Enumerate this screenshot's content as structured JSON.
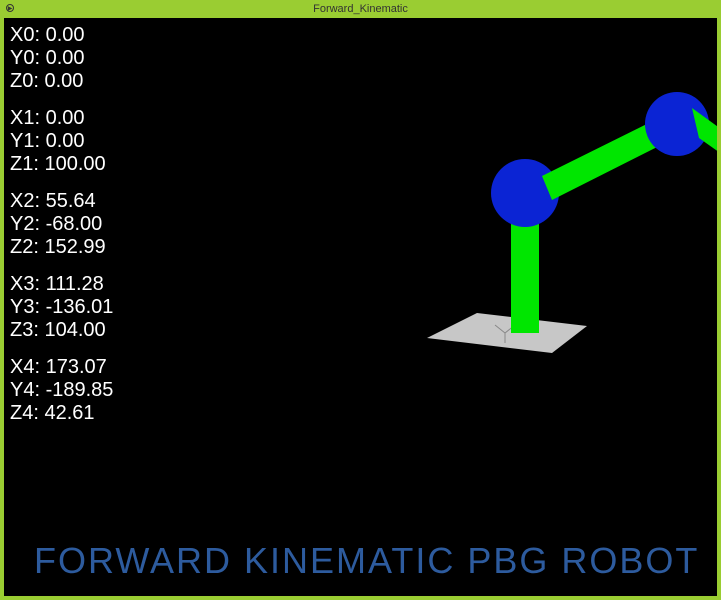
{
  "window": {
    "title": "Forward_Kinematic",
    "icon_name": "play-icon"
  },
  "coords": [
    {
      "X": "0.00",
      "Y": "0.00",
      "Z": "0.00"
    },
    {
      "X": "0.00",
      "Y": "0.00",
      "Z": "100.00"
    },
    {
      "X": "55.64",
      "Y": "-68.00",
      "Z": "152.99"
    },
    {
      "X": "111.28",
      "Y": "-136.01",
      "Z": "104.00"
    },
    {
      "X": "173.07",
      "Y": "-189.85",
      "Z": "42.61"
    }
  ],
  "footer": {
    "title": "FORWARD KINEMATIC PBG ROBOT"
  },
  "colors": {
    "titlebar": "#9acd32",
    "link_green": "#00e600",
    "joint_blue": "#0b24d4",
    "base_plate": "#c7c7c7",
    "footer_text": "#2d5b9e"
  }
}
